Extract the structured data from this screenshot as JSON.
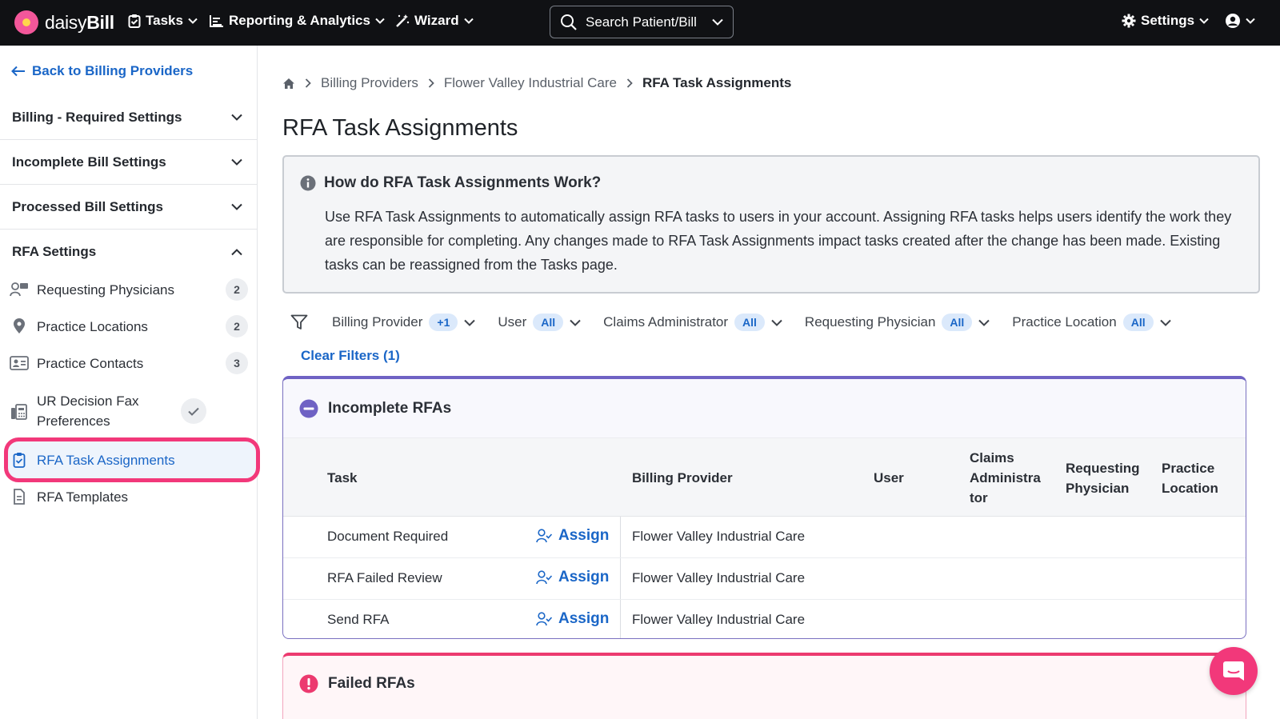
{
  "topbar": {
    "brand_light": "daisy",
    "brand_bold": "Bill",
    "nav": {
      "tasks": "Tasks",
      "reporting": "Reporting & Analytics",
      "wizard": "Wizard",
      "settings": "Settings"
    },
    "search_label": "Search Patient/Bill"
  },
  "sidebar": {
    "back_label": "Back to Billing Providers",
    "sections": {
      "billing_required": "Billing - Required Settings",
      "incomplete_bill": "Incomplete Bill Settings",
      "processed_bill": "Processed Bill Settings",
      "rfa_settings": "RFA Settings"
    },
    "items": [
      {
        "label": "Requesting Physicians",
        "badge": "2",
        "icon": "physicians-icon"
      },
      {
        "label": "Practice Locations",
        "badge": "2",
        "icon": "location-pin-icon"
      },
      {
        "label": "Practice Contacts",
        "badge": "3",
        "icon": "contact-card-icon"
      },
      {
        "label": "UR Decision Fax Preferences",
        "icon": "fax-icon"
      },
      {
        "label": "RFA Task Assignments",
        "icon": "clipboard-check-icon"
      },
      {
        "label": "RFA Templates",
        "icon": "document-icon"
      }
    ]
  },
  "breadcrumb": {
    "items": [
      "Billing Providers",
      "Flower Valley Industrial Care"
    ],
    "current": "RFA Task Assignments"
  },
  "page_title": "RFA Task Assignments",
  "info": {
    "heading": "How do RFA Task Assignments Work?",
    "body": "Use RFA Task Assignments to automatically assign RFA tasks to users in your account. Assigning RFA tasks helps users identify the work they are responsible for completing. Any changes made to RFA Task Assignments impact tasks created after the change has been made. Existing tasks can be reassigned from the Tasks page."
  },
  "filters": [
    {
      "label": "Billing Provider",
      "value": "+1"
    },
    {
      "label": "User",
      "value": "All"
    },
    {
      "label": "Claims Administrator",
      "value": "All"
    },
    {
      "label": "Requesting Physician",
      "value": "All"
    },
    {
      "label": "Practice Location",
      "value": "All"
    }
  ],
  "clear_filters": "Clear Filters (1)",
  "incomplete_card": {
    "title": "Incomplete RFAs",
    "columns": {
      "task": "Task",
      "billing_provider": "Billing Provider",
      "user": "User",
      "claims_admin": "Claims Administra tor",
      "requesting_physician": "Requesting Physician",
      "practice_location": "Practice Location"
    },
    "assign_label": "Assign",
    "rows": [
      {
        "task": "Document Required",
        "billing_provider": "Flower Valley Industrial Care"
      },
      {
        "task": "RFA Failed Review",
        "billing_provider": "Flower Valley Industrial Care"
      },
      {
        "task": "Send RFA",
        "billing_provider": "Flower Valley Industrial Care"
      }
    ]
  },
  "failed_card": {
    "title": "Failed RFAs"
  },
  "colors": {
    "accent_blue": "#1a66c7",
    "highlight_pink": "#f2387a",
    "incomplete_purple": "#6f62c4",
    "failed_red": "#ec3a6f"
  }
}
